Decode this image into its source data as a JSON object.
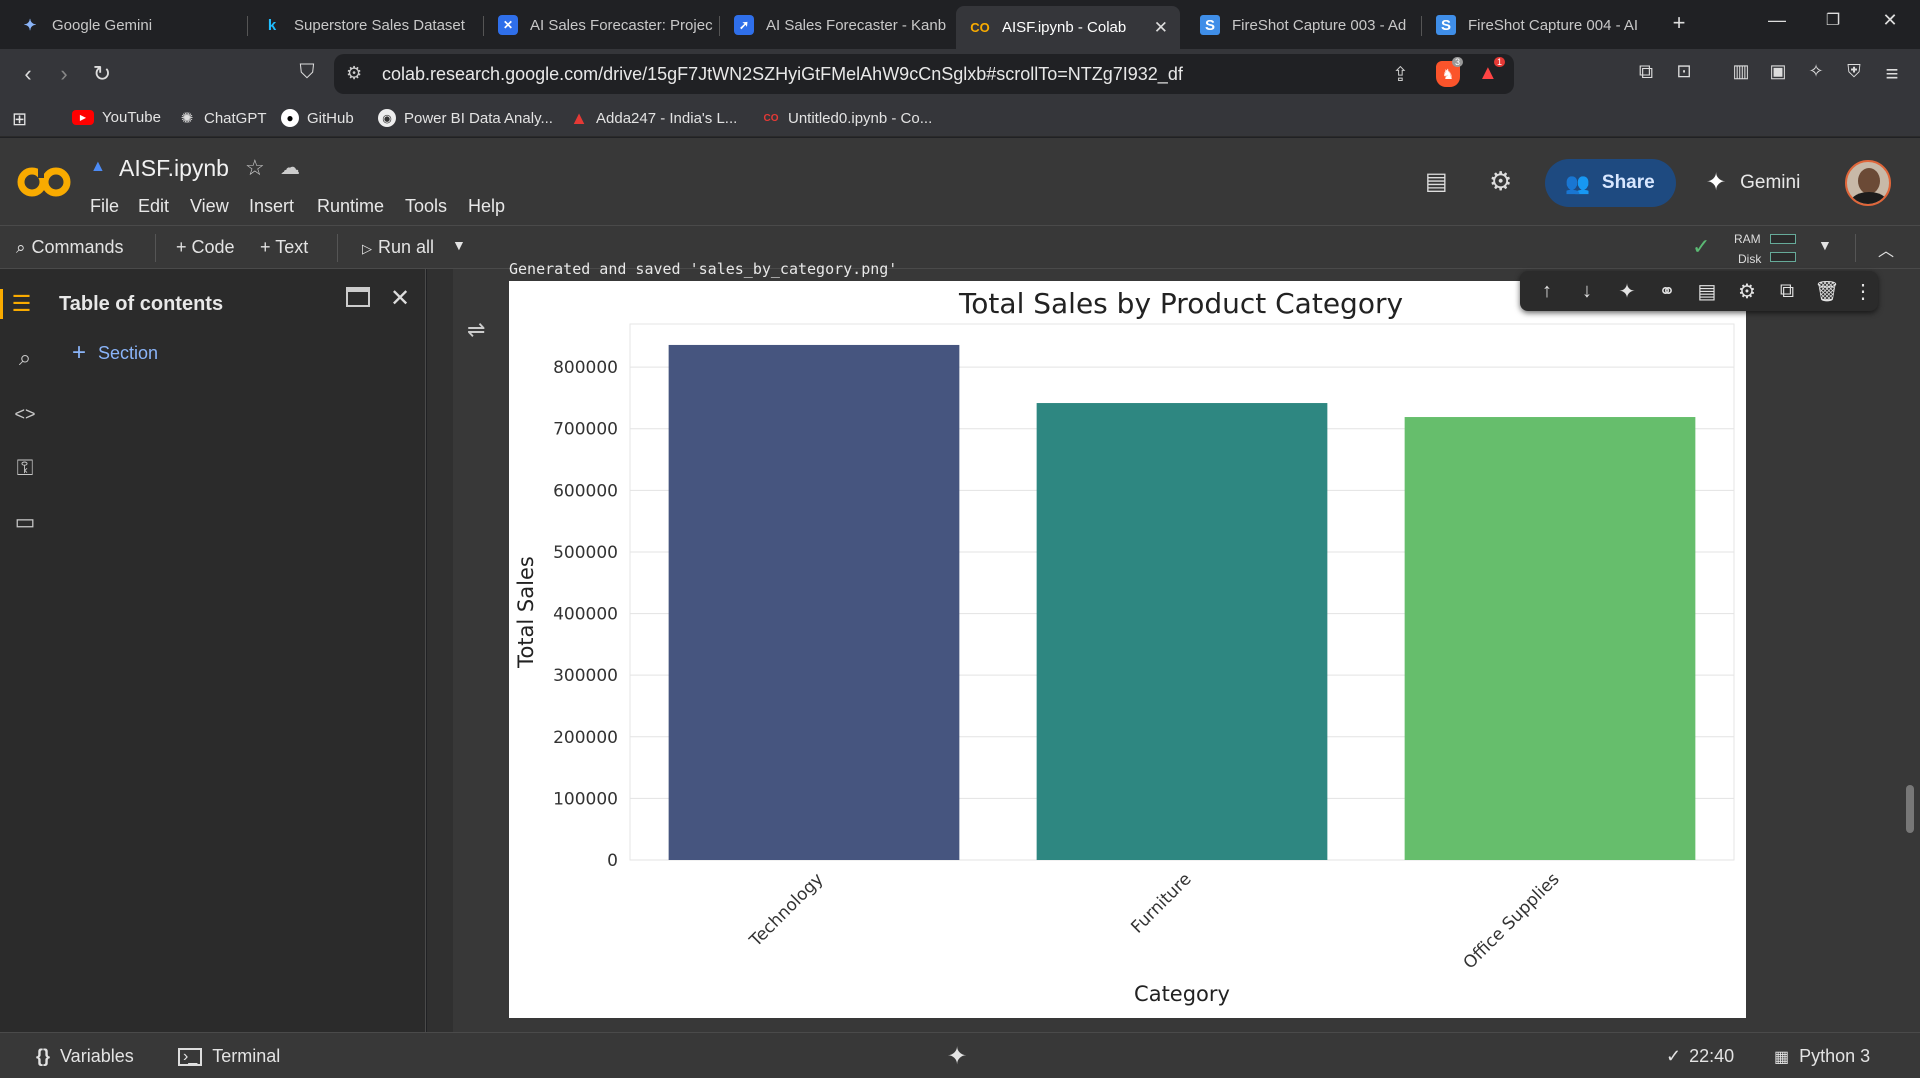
{
  "browser": {
    "tabs": [
      {
        "title": "Google Gemini",
        "icon": "gemini-icon"
      },
      {
        "title": "Superstore Sales Dataset",
        "icon": "kaggle-icon"
      },
      {
        "title": "AI Sales Forecaster: Projec",
        "icon": "jira-icon"
      },
      {
        "title": "AI Sales Forecaster - Kanb",
        "icon": "kanban-icon"
      },
      {
        "title": "AISF.ipynb - Colab",
        "icon": "colab-icon",
        "active": true
      },
      {
        "title": "FireShot Capture 003 - Ad",
        "icon": "fireshot-icon"
      },
      {
        "title": "FireShot Capture 004 - AI",
        "icon": "fireshot-icon"
      }
    ],
    "url": "colab.research.google.com/drive/15gF7JtWN2SZHyiGtFMelAhW9cCnSglxb#scrollTo=NTZg7I932_df",
    "brave_shield_count": "3",
    "alert_count": "1",
    "bookmarks": [
      {
        "label": "YouTube",
        "icon": "youtube-icon"
      },
      {
        "label": "ChatGPT",
        "icon": "chatgpt-icon"
      },
      {
        "label": "GitHub",
        "icon": "github-icon"
      },
      {
        "label": "Power BI Data Analy...",
        "icon": "powerbi-icon"
      },
      {
        "label": "Adda247 - India's L...",
        "icon": "adda-icon"
      },
      {
        "label": "Untitled0.ipynb - Co...",
        "icon": "colab-icon"
      }
    ]
  },
  "colab": {
    "notebook_title": "AISF.ipynb",
    "menu": [
      "File",
      "Edit",
      "View",
      "Insert",
      "Runtime",
      "Tools",
      "Help"
    ],
    "share_label": "Share",
    "gemini_label": "Gemini",
    "commands_label": "Commands",
    "code_label": "+ Code",
    "text_label": "+ Text",
    "run_all_label": "Run all",
    "ram_label": "RAM",
    "disk_label": "Disk",
    "toc_title": "Table of contents",
    "section_label": "Section",
    "output_text": "Generated and saved 'sales_by_category.png'",
    "status": {
      "variables": "Variables",
      "terminal": "Terminal",
      "time": "22:40",
      "runtime": "Python 3"
    }
  },
  "chart_data": {
    "type": "bar",
    "title": "Total Sales by Product Category",
    "xlabel": "Category",
    "ylabel": "Total Sales",
    "categories": [
      "Technology",
      "Furniture",
      "Office Supplies"
    ],
    "values": [
      836000,
      741700,
      719000
    ],
    "colors": [
      "#46557f",
      "#2e8781",
      "#66be6c"
    ],
    "ylim": [
      0,
      870000
    ],
    "yticks": [
      "0",
      "100000",
      "200000",
      "300000",
      "400000",
      "500000",
      "600000",
      "700000",
      "800000"
    ],
    "grid": true
  }
}
